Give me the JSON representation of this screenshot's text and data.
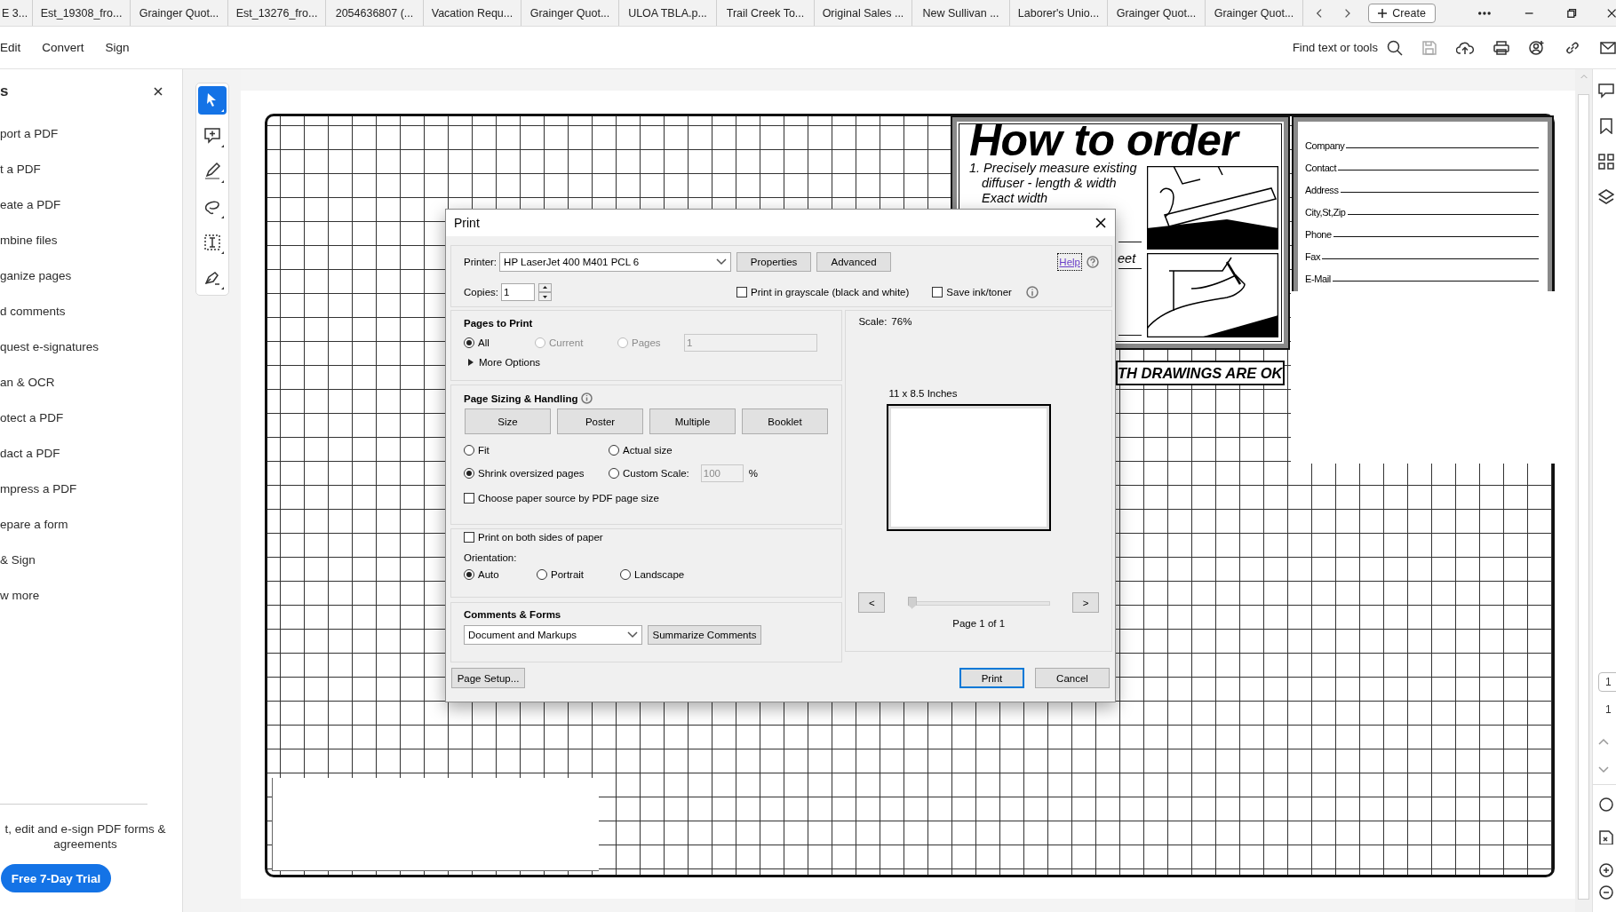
{
  "tabs": [
    {
      "label": "E 3..."
    },
    {
      "label": "Est_19308_fro..."
    },
    {
      "label": "Grainger Quot..."
    },
    {
      "label": "Est_13276_fro..."
    },
    {
      "label": "2054636807 (..."
    },
    {
      "label": "Vacation Requ..."
    },
    {
      "label": "Grainger Quot..."
    },
    {
      "label": "ULOA TBLA.p..."
    },
    {
      "label": "Trail Creek To..."
    },
    {
      "label": "Original Sales ..."
    },
    {
      "label": "New Sullivan ..."
    },
    {
      "label": "Laborer's Unio..."
    },
    {
      "label": "Grainger Quot..."
    },
    {
      "label": "Grainger Quot..."
    }
  ],
  "create_button": "Create",
  "menu": [
    "Edit",
    "Convert",
    "Sign"
  ],
  "search_label": "Find text or tools",
  "tools_panel": {
    "title": "s",
    "items": [
      "port a PDF",
      "t a PDF",
      "eate a PDF",
      "mbine files",
      "ganize pages",
      "d comments",
      "quest e-signatures",
      "an & OCR",
      "otect a PDF",
      "dact a PDF",
      "mpress a PDF",
      "epare a form",
      "& Sign",
      "w more"
    ],
    "promo": "t, edit and e-sign PDF forms & agreements",
    "trial_button": "Free 7-Day Trial"
  },
  "tool_rail": [
    {
      "kind": "select",
      "selected": true
    },
    {
      "kind": "comment",
      "selected": false
    },
    {
      "kind": "highlight",
      "selected": false
    },
    {
      "kind": "draw",
      "selected": false
    },
    {
      "kind": "text",
      "selected": false
    },
    {
      "kind": "sign",
      "selected": false
    }
  ],
  "document": {
    "heading": "How to order",
    "steps": [
      "1. Precisely measure existing",
      "diffuser - length & width",
      "Exact width"
    ],
    "partial_text": "eet",
    "banner": "TH DRAWINGS ARE OK",
    "contact_fields": [
      "Company",
      "Contact",
      "Address",
      "City,St,Zip",
      "Phone",
      "Fax",
      "E-Mail"
    ]
  },
  "print_dialog": {
    "title": "Print",
    "printer_label": "Printer:",
    "printer": "HP LaserJet 400 M401 PCL 6",
    "properties_button": "Properties",
    "advanced_button": "Advanced",
    "help_link": "Help",
    "copies_label": "Copies:",
    "copies": "1",
    "options": [
      {
        "label": "Print in grayscale (black and white)",
        "checked": false
      },
      {
        "label": "Save ink/toner",
        "checked": false
      }
    ],
    "pages_to_print": {
      "title": "Pages to Print",
      "choices": [
        {
          "label": "All",
          "selected": true,
          "disabled": false
        },
        {
          "label": "Current",
          "selected": false,
          "disabled": true
        },
        {
          "label": "Pages",
          "selected": false,
          "disabled": true
        }
      ],
      "pages_value": "1",
      "more_options": "More Options",
      "expanded": false
    },
    "page_sizing": {
      "title": "Page Sizing & Handling",
      "modes": [
        "Size",
        "Poster",
        "Multiple",
        "Booklet"
      ],
      "scaling": [
        {
          "label": "Fit",
          "selected": false
        },
        {
          "label": "Actual size",
          "selected": false
        },
        {
          "label": "Shrink oversized pages",
          "selected": true
        },
        {
          "label": "Custom Scale:",
          "selected": false,
          "field": "100",
          "unit": "%"
        }
      ],
      "paper_source": {
        "label": "Choose paper source by PDF page size",
        "checked": false
      }
    },
    "duplex": {
      "label": "Print on both sides of paper",
      "checked": false
    },
    "orientation": {
      "title": "Orientation:",
      "choices": [
        {
          "label": "Auto",
          "selected": true
        },
        {
          "label": "Portrait",
          "selected": false
        },
        {
          "label": "Landscape",
          "selected": false
        }
      ]
    },
    "comments_forms": {
      "title": "Comments & Forms",
      "value": "Document and Markups",
      "summarize_button": "Summarize Comments"
    },
    "preview": {
      "scale_label": "Scale:",
      "scale_value": "76%",
      "paper": "11 x 8.5 Inches",
      "prev": "<",
      "next": ">",
      "level": 0,
      "page_label": "Page 1 of 1"
    },
    "page_setup_button": "Page Setup...",
    "print_button": "Print",
    "cancel_button": "Cancel"
  },
  "right_rail": {
    "page_field": "1",
    "page_count": "1"
  }
}
